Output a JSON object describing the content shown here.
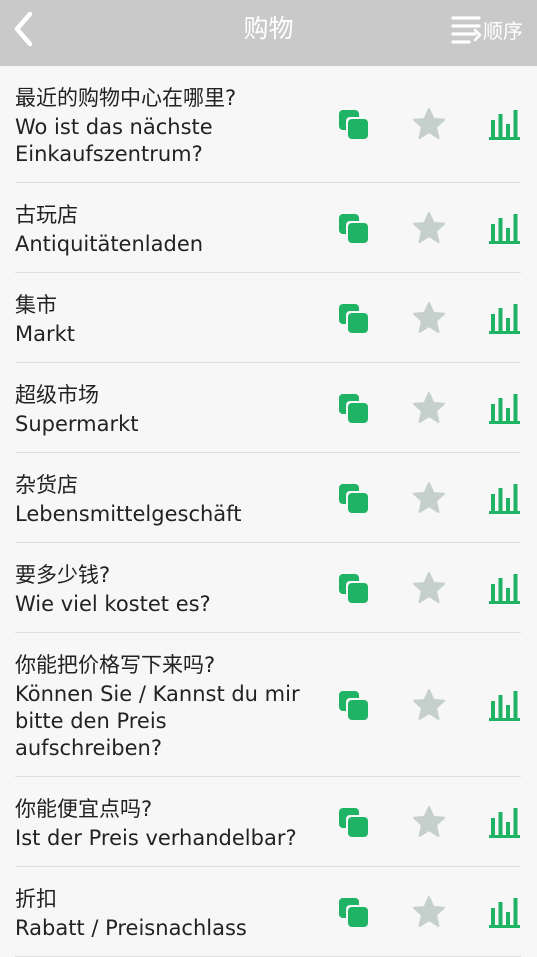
{
  "header": {
    "title": "购物",
    "sort_label": "顺序"
  },
  "colors": {
    "header_bg": "#c9c9c9",
    "accent_green": "#1fb365",
    "star_gray": "#c5cfcc"
  },
  "icons": {
    "back": "chevron-left-icon",
    "sort": "sort-list-icon",
    "copy": "copy-icon",
    "favorite": "star-icon",
    "stats": "bar-chart-icon"
  },
  "phrases": [
    {
      "zh": "最近的购物中心在哪里?",
      "de": "Wo ist das nächste Einkaufszentrum?"
    },
    {
      "zh": "古玩店",
      "de": "Antiquitätenladen"
    },
    {
      "zh": "集市",
      "de": "Markt"
    },
    {
      "zh": "超级市场",
      "de": "Supermarkt"
    },
    {
      "zh": "杂货店",
      "de": "Lebensmittelgeschäft"
    },
    {
      "zh": "要多少钱?",
      "de": "Wie viel kostet es?"
    },
    {
      "zh": "你能把价格写下来吗?",
      "de": "Können Sie / Kannst du mir bitte den Preis aufschreiben?"
    },
    {
      "zh": "你能便宜点吗?",
      "de": "Ist der Preis verhandelbar?"
    },
    {
      "zh": "折扣",
      "de": "Rabatt / Preisnachlass"
    }
  ]
}
